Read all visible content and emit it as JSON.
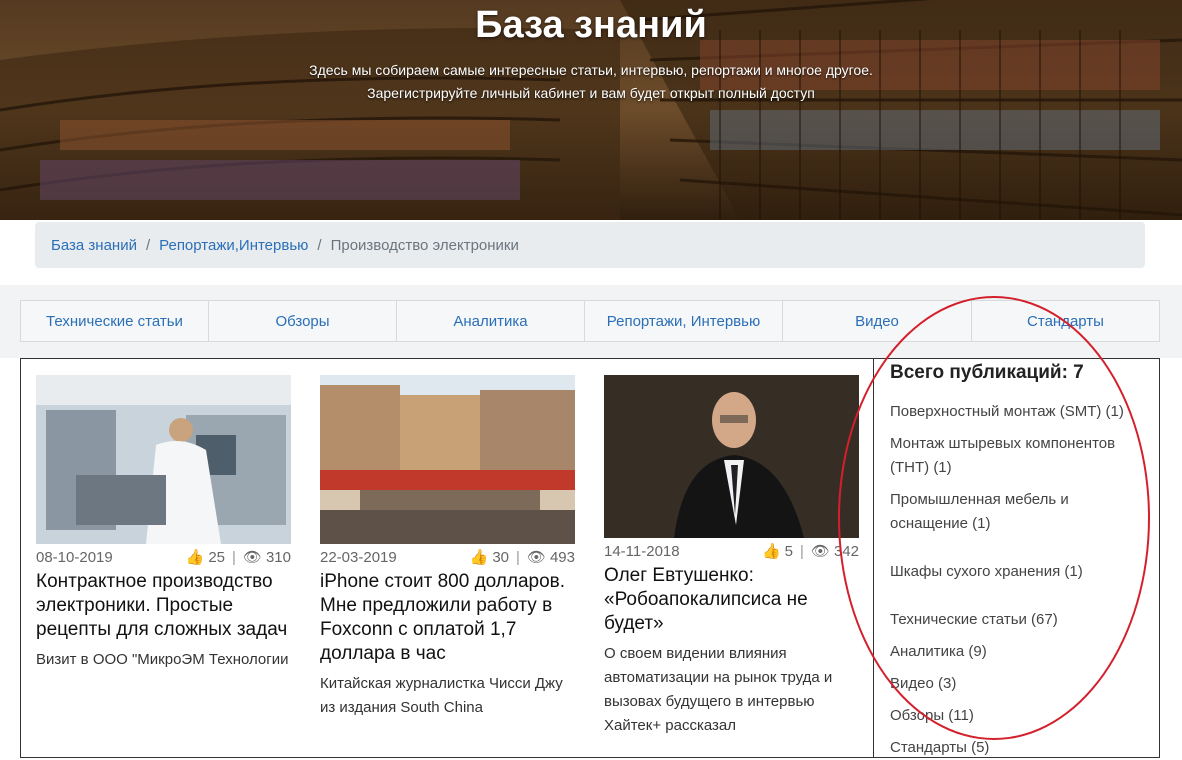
{
  "hero": {
    "title": "База знаний",
    "subtitle_line1": "Здесь мы собираем самые интересные статьи, интервью, репортажи и многое другое.",
    "subtitle_line2": "Зарегистрируйте личный кабинет и вам будет открыт полный доступ"
  },
  "breadcrumb": {
    "items": [
      "База знаний",
      "Репортажи,Интервью"
    ],
    "current": "Производство электроники",
    "separator": "/"
  },
  "tabs": [
    "Технические статьи",
    "Обзоры",
    "Аналитика",
    "Репортажи, Интервью",
    "Видео",
    "Стандарты"
  ],
  "cards": [
    {
      "date": "08-10-2019",
      "likes": "25",
      "views": "310",
      "title": "Контрактное производство электроники. Простые рецепты для сложных задач",
      "excerpt": "Визит в ООО \"МикроЭМ Технологии"
    },
    {
      "date": "22-03-2019",
      "likes": "30",
      "views": "493",
      "title": "iPhone стоит 800 долларов. Мне предложили работу в Foxconn с оплатой 1,7 доллара в час",
      "excerpt": "Китайская журналистка Чисси Джу из издания South China"
    },
    {
      "date": "14-11-2018",
      "likes": "5",
      "views": "342",
      "title": "Олег Евтушенко: «Робоапокалипсиса не будет»",
      "excerpt": "О своем видении влияния автоматизации на рынок труда и вызовах будущего в интервью Хайтек+ рассказал"
    }
  ],
  "sidebar": {
    "total_label": "Всего публикаций: 7",
    "items": [
      "Поверхностный монтаж (SMT) (1)",
      "Монтаж штыревых компонентов (THT) (1)",
      "Промышленная мебель и оснащение (1)",
      "Шкафы сухого хранения (1)",
      "Технические статьи (67)",
      "Аналитика (9)",
      "Видео (3)",
      "Обзоры (11)",
      "Стандарты (5)"
    ]
  },
  "icons": {
    "like": "thumbs-up-icon",
    "views": "eye-icon"
  },
  "colors": {
    "link": "#2a6fb8",
    "annotation": "#d4202c"
  }
}
